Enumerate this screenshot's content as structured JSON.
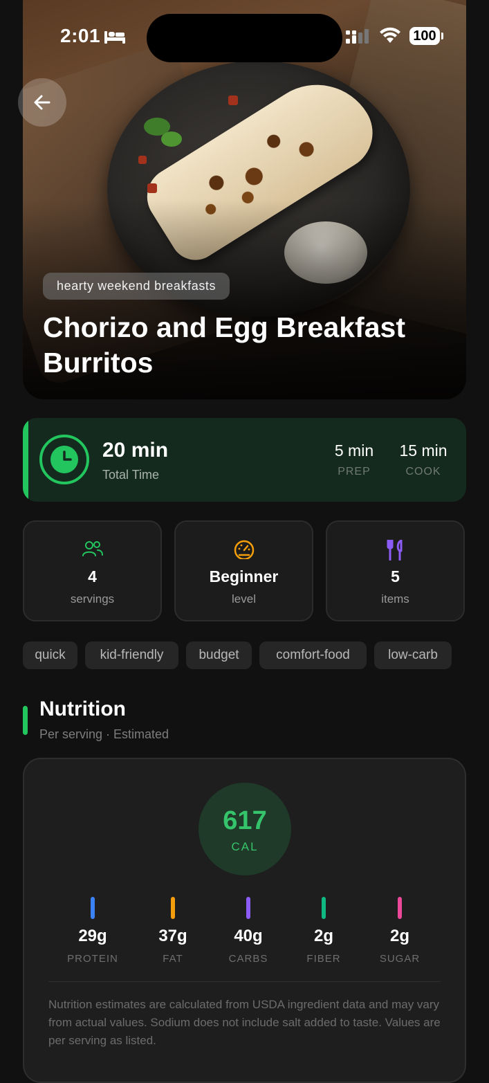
{
  "status_bar": {
    "time": "2:01",
    "battery": "100"
  },
  "hero": {
    "category": "hearty weekend breakfasts",
    "title": "Chorizo and Egg Breakfast Burritos"
  },
  "time_card": {
    "total_value": "20 min",
    "total_label": "Total Time",
    "prep_value": "5 min",
    "prep_label": "PREP",
    "cook_value": "15 min",
    "cook_label": "COOK",
    "accent_color": "#22c55e"
  },
  "stats": [
    {
      "icon": "users-icon",
      "value": "4",
      "label": "servings",
      "color": "#22c55e"
    },
    {
      "icon": "gauge-icon",
      "value": "Beginner",
      "label": "level",
      "color": "#f59e0b"
    },
    {
      "icon": "utensils-icon",
      "value": "5",
      "label": "items",
      "color": "#8b5cf6"
    }
  ],
  "tags": [
    "quick",
    "kid-friendly",
    "budget",
    "comfort-food",
    "low-carb"
  ],
  "nutrition": {
    "title": "Nutrition",
    "subtitle": "Per serving · Estimated",
    "calories": "617",
    "calories_label": "CAL",
    "macros": [
      {
        "value": "29g",
        "label": "PROTEIN",
        "color": "#3b82f6"
      },
      {
        "value": "37g",
        "label": "FAT",
        "color": "#f59e0b"
      },
      {
        "value": "40g",
        "label": "CARBS",
        "color": "#8b5cf6"
      },
      {
        "value": "2g",
        "label": "FIBER",
        "color": "#10b981"
      },
      {
        "value": "2g",
        "label": "SUGAR",
        "color": "#ec4899"
      }
    ],
    "note": "Nutrition estimates are calculated from USDA ingredient data and may vary from actual values. Sodium does not include salt added to taste. Values are per serving as listed."
  }
}
